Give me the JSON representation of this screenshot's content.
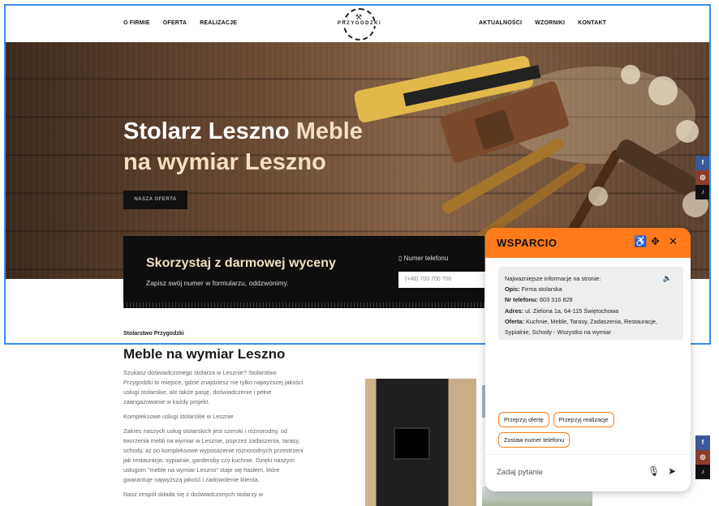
{
  "nav": {
    "left": [
      "O FIRMIE",
      "OFERTA",
      "REALIZACJE"
    ],
    "right": [
      "AKTUALNOŚCI",
      "WZORNIKI",
      "KONTAKT"
    ],
    "logo_text": "PRZYGODZKI"
  },
  "hero": {
    "title_part1": "Stolarz Leszno ",
    "title_accent": "Meble",
    "title_part2": "na wymiar Leszno",
    "button": "NASZA OFERTA"
  },
  "quote": {
    "title": "Skorzystaj z darmowej wyceny",
    "subtitle": "Zapisz swój numer w formularzu, oddzwonimy.",
    "phone_label": "Numer telefonu",
    "phone_placeholder": "(+48) 700 700 700"
  },
  "social": {
    "fb": "f",
    "ig": "◎",
    "tt": "♪"
  },
  "content": {
    "kicker": "Stolarstwo Przygodzki",
    "heading": "Meble na wymiar Leszno",
    "p1": "Szukasz doświadczonego stolarza w Lesznie? Stolarstwo Przygodzki to miejsce, gdzie znajdziesz nie tylko najwyższej jakości usługi stolarskie, ale także pasję, doświadczenie i pełne zaangażowanie w każdy projekt.",
    "p2": "Kompleksowe usługi stolarskie w Lesznie",
    "p3": "Zakres naszych usług stolarskich jest szeroki i różnorodny, od tworzenia mebli na wymiar w Lesznie, poprzez zadaszenia, tarasy, schody, aż po kompleksowe wyposażenie różnorodnych przestrzeni jak restauracje, sypialnie, garderoby czy kuchnie. Dzięki naszym usługom \"meble na wymiar Leszno\" staje się hasłem, które gwarantuje najwyższą jakość i zadowolenie klienta.",
    "p4": "Nasz zespół składa się z doświadczonych stolarzy w"
  },
  "chat": {
    "title": "WSPARCIO",
    "intro": "Najważniejsze informacje na stronie:",
    "rows": [
      {
        "k": "Opis:",
        "v": " Firma stolarska"
      },
      {
        "k": "Nr telefonu:",
        "v": " 603 316 828"
      },
      {
        "k": "Adres:",
        "v": " ul. Zielona 1a, 64-115 Świętochowa"
      },
      {
        "k": "Oferta:",
        "v": " Kuchnie, Meble, Tarasy, Zadaszenia, Restauracje, Sypialnie, Schody - Wszystko na wymiar"
      }
    ],
    "chips": [
      "Przejrzyj ofertę",
      "Przejrzyj realizacje",
      "Zostaw numer telefonu"
    ],
    "input_placeholder": "Zadaj pytanie"
  },
  "colors": {
    "accent": "#ff7a1a",
    "cream": "#f3e0c2",
    "frame": "#3a8ee6"
  }
}
